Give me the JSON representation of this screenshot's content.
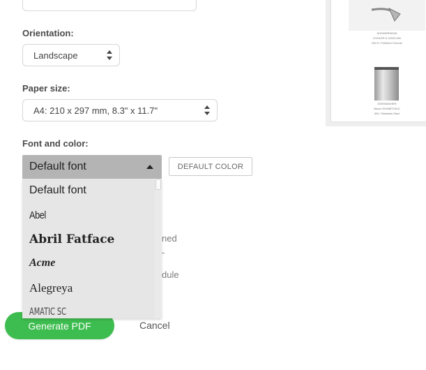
{
  "form": {
    "orientation": {
      "label": "Orientation:",
      "value": "Landscape"
    },
    "paper_size": {
      "label": "Paper size:",
      "value": "A4: 210 x 297 mm, 8.3\" x 11.7\""
    },
    "font_color": {
      "label": "Font and color:",
      "selected": "Default font",
      "default_color_label": "DEFAULT COLOR",
      "options": [
        "Default font",
        "Abel",
        "Abril Fatface",
        "Acme",
        "Alegreya",
        "Amatic SC"
      ]
    },
    "partial_texts": [
      "ned",
      "-",
      "dule"
    ]
  },
  "preview": {
    "item1_title": "SHOWERHEAD",
    "item1_line1": "KOHLER K-10921-BN",
    "item1_line2": "200.5 / Polished Chrome",
    "item2_title": "DISHWASHER",
    "item2_line1": "Bosch SHX88T15UC",
    "item2_line2": "504 / Stainless Steel"
  },
  "actions": {
    "generate_label": "Generate PDF",
    "cancel_label": "Cancel"
  },
  "colors": {
    "accent_green": "#3dbd4f",
    "dropdown_bg": "#e6e6e6",
    "dropdown_selected_bg": "#b4b4b4"
  }
}
